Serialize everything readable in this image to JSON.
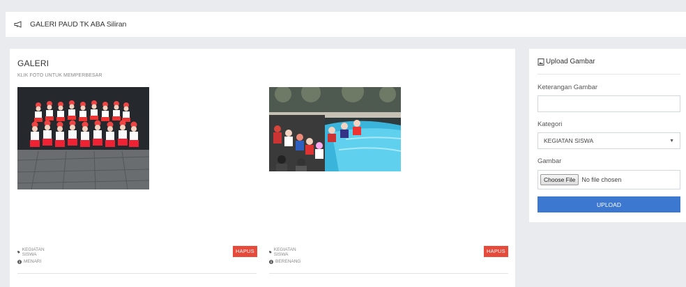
{
  "header": {
    "title": "GALERI PAUD TK ABA Siliran",
    "icon": "bullhorn-icon"
  },
  "gallery": {
    "title": "GALERI",
    "subtitle": "KLIK FOTO UNTUK MEMPERBESAR",
    "items": [
      {
        "category": "KEGIATAN SISWA",
        "caption": "MENARI",
        "delete_label": "HAPUS",
        "photo": "dance-photo"
      },
      {
        "category": "KEGIATAN SISWA",
        "caption": "BERENANG",
        "delete_label": "HAPUS",
        "photo": "swimming-photo"
      }
    ]
  },
  "upload": {
    "title": "Upload Gambar",
    "icon": "image-file-icon",
    "keterangan_label": "Keterangan Gambar",
    "keterangan_value": "",
    "kategori_label": "Kategori",
    "kategori_selected": "KEGIATAN SISWA",
    "gambar_label": "Gambar",
    "choose_file_label": "Choose File",
    "no_file_text": "No file chosen",
    "upload_label": "UPLOAD"
  },
  "colors": {
    "accent": "#3c77d0",
    "danger": "#e64a3b",
    "background": "#e9ebef"
  }
}
